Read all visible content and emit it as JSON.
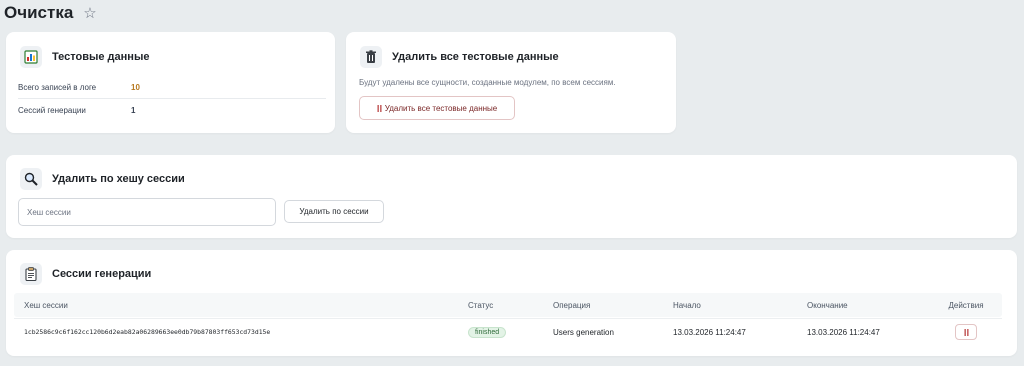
{
  "page": {
    "title": "Очистка"
  },
  "test_data_card": {
    "title": "Тестовые данные",
    "rows": [
      {
        "label": "Всего записей в логе",
        "value": "10",
        "color": "#b7791f"
      },
      {
        "label": "Сессий генерации",
        "value": "1",
        "color": "#1f2328"
      }
    ]
  },
  "delete_all_card": {
    "title": "Удалить все тестовые данные",
    "description": "Будут удалены все сущности, созданные модулем, по всем сессиям.",
    "button_label": "Удалить все тестовые данные"
  },
  "delete_hash_card": {
    "title": "Удалить по хешу сессии",
    "input_placeholder": "Хеш сессии",
    "input_value": "",
    "button_label": "Удалить по сессии"
  },
  "sessions_card": {
    "title": "Сессии генерации",
    "columns": {
      "hash": "Хеш сессии",
      "status": "Статус",
      "operation": "Операция",
      "start": "Начало",
      "end": "Окончание",
      "actions": "Действия"
    },
    "rows": [
      {
        "hash": "1cb2586c9c6f162cc120b6d2eab82a06289663ee0db79b87803ff653cd73d15e",
        "status": "finished",
        "operation": "Users generation",
        "start": "13.03.2026 11:24:47",
        "end": "13.03.2026 11:24:47"
      }
    ]
  },
  "colors": {
    "danger": "#7a2626",
    "status_finished_bg": "#e3f3e6",
    "status_finished_text": "#2f6b3a"
  },
  "icons": [
    "star-icon",
    "bar-chart-icon",
    "trash-icon",
    "search-icon",
    "clipboard-icon",
    "delete-icon"
  ]
}
